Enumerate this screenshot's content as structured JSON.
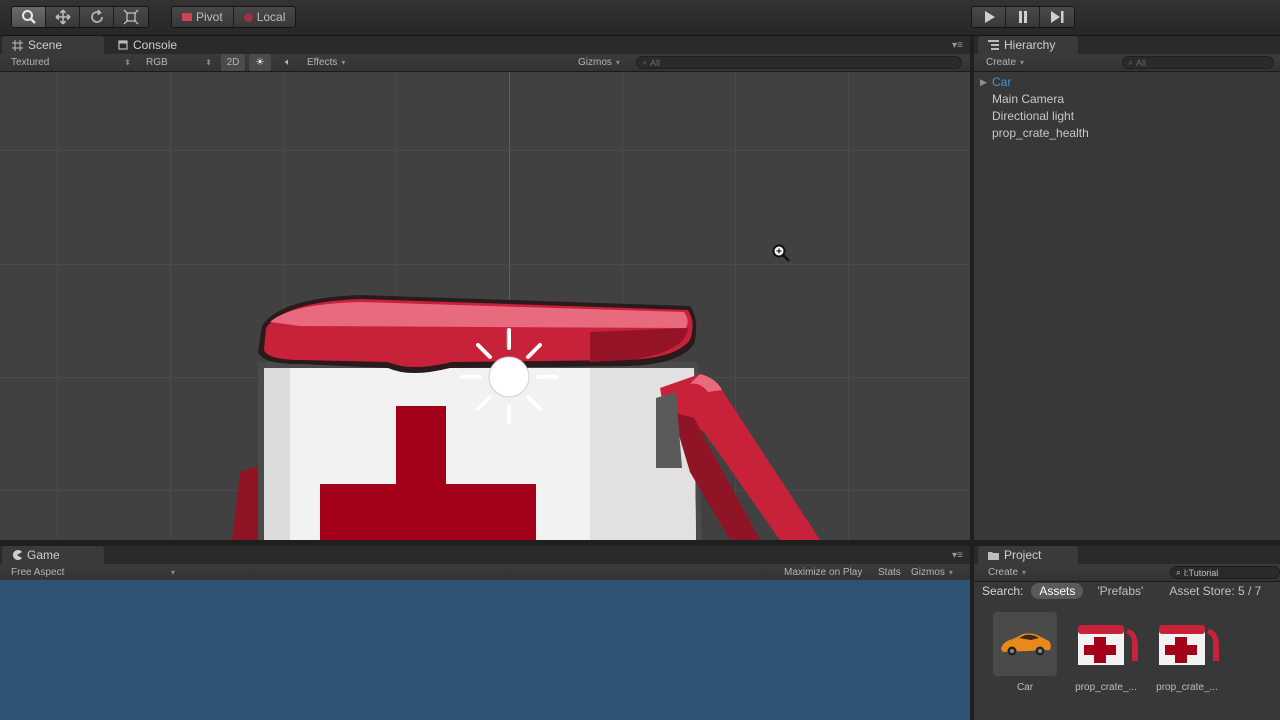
{
  "toolbar": {
    "pivot_label": "Pivot",
    "local_label": "Local"
  },
  "scene_panel": {
    "tab_scene": "Scene",
    "tab_console": "Console",
    "render_mode": "Textured",
    "color_mode": "RGB",
    "toggle_2d": "2D",
    "effects_label": "Effects",
    "gizmos_label": "Gizmos",
    "search_placeholder": "All"
  },
  "hierarchy": {
    "tab_label": "Hierarchy",
    "create_label": "Create",
    "search_placeholder": "All",
    "items": [
      {
        "label": "Car"
      },
      {
        "label": "Main Camera"
      },
      {
        "label": "Directional light"
      },
      {
        "label": "prop_crate_health"
      }
    ]
  },
  "game_panel": {
    "tab_label": "Game",
    "aspect": "Free Aspect",
    "maximize_label": "Maximize on Play",
    "stats_label": "Stats",
    "gizmos_label": "Gizmos"
  },
  "project": {
    "tab_label": "Project",
    "create_label": "Create",
    "search_value": "l:Tutorial",
    "search_label": "Search:",
    "filter_assets": "Assets",
    "filter_prefabs": "'Prefabs'",
    "asset_store": "Asset Store: 5 / 7",
    "assets": [
      {
        "label": "Car"
      },
      {
        "label": "prop_crate_..."
      },
      {
        "label": "prop_crate_..."
      }
    ]
  },
  "colors": {
    "crate_red": "#c8223a",
    "crate_dark_red": "#a3001a",
    "game_bg": "#2f5375",
    "selected_text": "#4a90d9"
  }
}
